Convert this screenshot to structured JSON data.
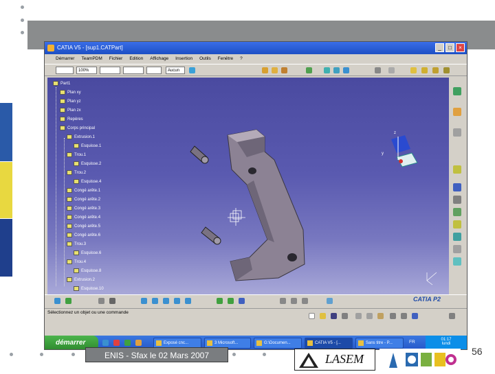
{
  "window": {
    "title": "CATIA V5 - [sup1.CATPart]"
  },
  "menubar": {
    "items": [
      "Démarrer",
      "TeamPDM",
      "Fichier",
      "Edition",
      "Affichage",
      "Insertion",
      "Outils",
      "Fenêtre",
      "?"
    ]
  },
  "toolbar": {
    "zoom_value": "100%",
    "render_mode": "Aucun"
  },
  "tree": {
    "items": [
      {
        "label": "Part1"
      },
      {
        "label": "Plan xy"
      },
      {
        "label": "Plan yz"
      },
      {
        "label": "Plan zx"
      },
      {
        "label": "Repères"
      },
      {
        "label": "Corps principal"
      },
      {
        "label": "Extrusion.1"
      },
      {
        "label": "Esquisse.1"
      },
      {
        "label": "Trou.1"
      },
      {
        "label": "Esquisse.2"
      },
      {
        "label": "Trou.2"
      },
      {
        "label": "Esquisse.4"
      },
      {
        "label": "Congé arête.1"
      },
      {
        "label": "Congé arête.2"
      },
      {
        "label": "Congé arête.3"
      },
      {
        "label": "Congé arête.4"
      },
      {
        "label": "Congé arête.5"
      },
      {
        "label": "Congé arête.6"
      },
      {
        "label": "Trou.3"
      },
      {
        "label": "Esquisse.6"
      },
      {
        "label": "Trou.4"
      },
      {
        "label": "Esquisse.8"
      },
      {
        "label": "Extrusion.2"
      },
      {
        "label": "Esquisse.10"
      }
    ]
  },
  "status": {
    "message": "Sélectionnez un objet ou une commande"
  },
  "brand": {
    "catia": "CATIA P2"
  },
  "taskbar": {
    "start_label": "démarrer",
    "tasks": [
      {
        "label": "Exposé cnc..."
      },
      {
        "label": "3 Microsoft..."
      },
      {
        "label": "G:\\Documen..."
      },
      {
        "label": "CATIA V5 - [..."
      },
      {
        "label": "Sans titre - P..."
      }
    ],
    "lang": "FR",
    "clock": "01:17",
    "day": "lundi"
  },
  "slide": {
    "footer": "ENIS - Sfax le 02 Mars 2007",
    "page_number": "56",
    "logo_lasem": "LASEM"
  },
  "colors": {
    "viewport_top": "#4a4aa0",
    "viewport_bottom": "#a8a8d8",
    "part": "#8c8294",
    "side_blue": "#2a5aa8",
    "side_yellow": "#e8d840"
  }
}
